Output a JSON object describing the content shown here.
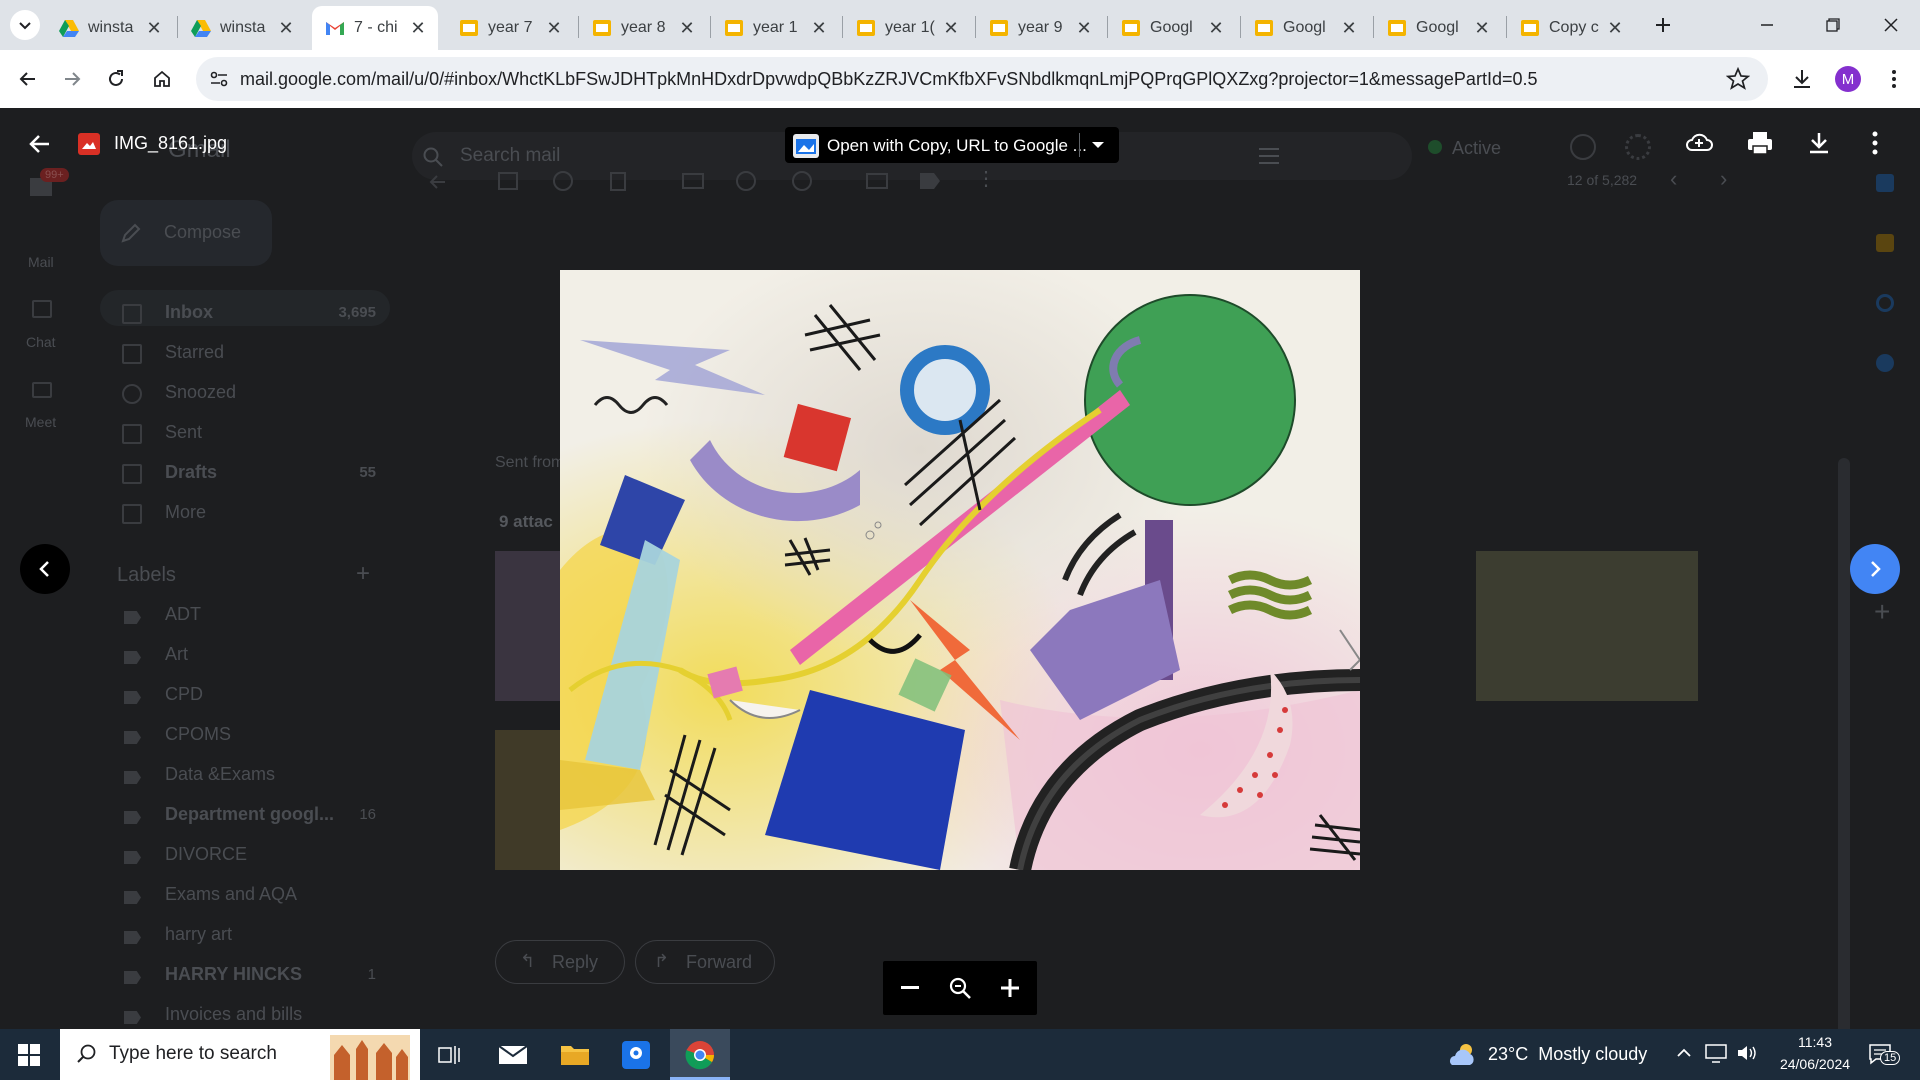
{
  "browser": {
    "tabs": [
      {
        "label": "winsta",
        "icon": "drive-icon"
      },
      {
        "label": "winsta",
        "icon": "drive-icon"
      },
      {
        "label": "7 - chi",
        "icon": "gmail-icon",
        "active": true
      },
      {
        "label": "year 7",
        "icon": "slides-icon"
      },
      {
        "label": "year 8",
        "icon": "slides-icon"
      },
      {
        "label": "year 1",
        "icon": "slides-icon"
      },
      {
        "label": "year 1(",
        "icon": "slides-icon"
      },
      {
        "label": "year 9",
        "icon": "slides-icon"
      },
      {
        "label": "Googl",
        "icon": "slides-icon"
      },
      {
        "label": "Googl",
        "icon": "slides-icon"
      },
      {
        "label": "Googl",
        "icon": "slides-icon"
      },
      {
        "label": "Copy c",
        "icon": "slides-icon"
      }
    ],
    "url": "mail.google.com/mail/u/0/#inbox/WhctKLbFSwJDHTpkMnHDxdrDpvwdpQBbKzZRJVCmKfbXFvSNbdlkmqnLmjPQPrqGPlQXZxg?projector=1&messagePartId=0.5",
    "profile_initial": "M"
  },
  "viewer": {
    "filename": "IMG_8161.jpg",
    "open_with": "Open with Copy, URL to Google ...",
    "image_alt": "Abstract watercolour painting with geometric shapes"
  },
  "gmail": {
    "logo": "Gmail",
    "search_placeholder": "Search mail",
    "status": "Active",
    "compose": "Compose",
    "mail_badge": "99+",
    "rail": [
      {
        "label": "Mail"
      },
      {
        "label": "Chat"
      },
      {
        "label": "Meet"
      }
    ],
    "nav": [
      {
        "label": "Inbox",
        "count": "3,695",
        "bold": true
      },
      {
        "label": "Starred",
        "count": ""
      },
      {
        "label": "Snoozed",
        "count": ""
      },
      {
        "label": "Sent",
        "count": ""
      },
      {
        "label": "Drafts",
        "count": "55",
        "bold": true
      },
      {
        "label": "More",
        "count": ""
      }
    ],
    "labels_title": "Labels",
    "labels": [
      {
        "label": "ADT",
        "count": ""
      },
      {
        "label": "Art",
        "count": ""
      },
      {
        "label": "CPD",
        "count": ""
      },
      {
        "label": "CPOMS",
        "count": ""
      },
      {
        "label": "Data &Exams",
        "count": ""
      },
      {
        "label": "Department googl...",
        "count": "16",
        "bold": true
      },
      {
        "label": "DIVORCE",
        "count": ""
      },
      {
        "label": "Exams and AQA",
        "count": ""
      },
      {
        "label": "harry art",
        "count": ""
      },
      {
        "label": "HARRY HINCKS",
        "count": "1",
        "bold": true
      },
      {
        "label": "Invoices and bills",
        "count": ""
      }
    ],
    "pager": "12 of 5,282",
    "sent_from": "Sent from",
    "attachments": "9 attac",
    "reply": "Reply",
    "forward": "Forward"
  },
  "taskbar": {
    "search_placeholder": "Type here to search",
    "weather": "23°C  Mostly cloudy",
    "time": "11:43",
    "date": "24/06/2024",
    "notifications": "15"
  }
}
